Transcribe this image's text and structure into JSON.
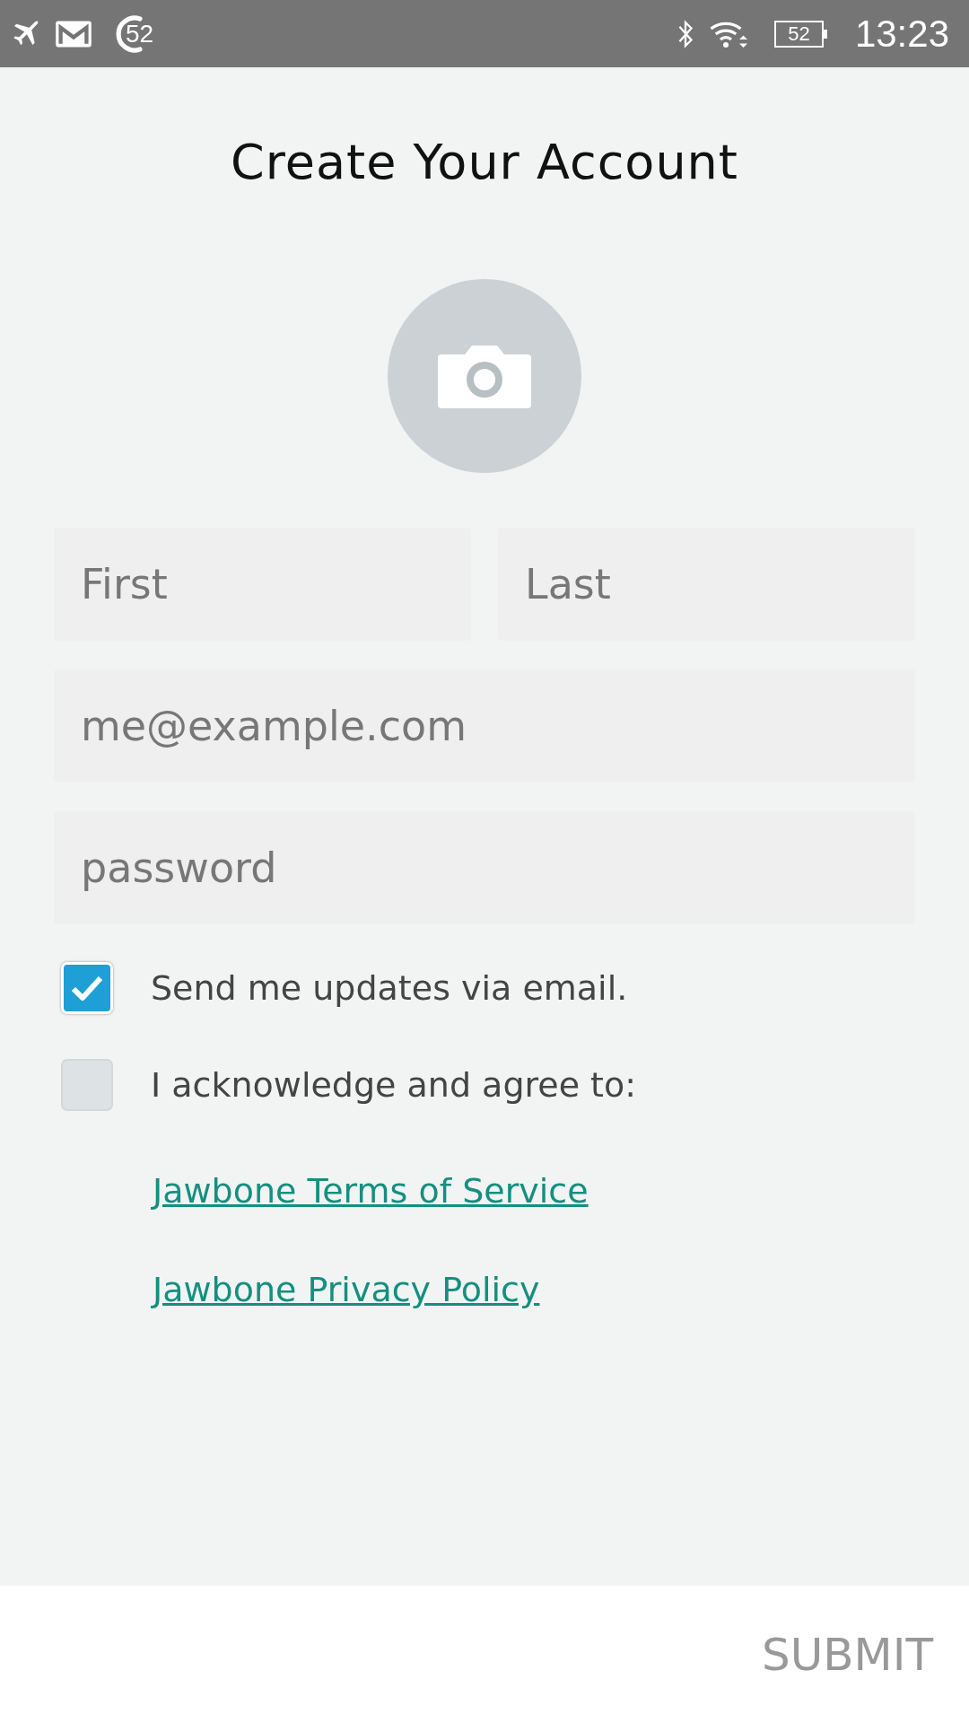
{
  "status_bar": {
    "notification_count": "52",
    "battery": "52",
    "time": "13:23"
  },
  "title": "Create Your Account",
  "name_fields": [
    {
      "placeholder": "First"
    },
    {
      "placeholder": "Last"
    }
  ],
  "email_field": {
    "placeholder": "me@example.com"
  },
  "password_field": {
    "placeholder": "password"
  },
  "checkboxes": [
    {
      "label": "Send me updates via email.",
      "checked": true
    },
    {
      "label": "I acknowledge and agree to:",
      "checked": false
    }
  ],
  "links": [
    "Jawbone Terms of Service",
    "Jawbone Privacy Policy"
  ],
  "submit_button": "SUBMIT"
}
